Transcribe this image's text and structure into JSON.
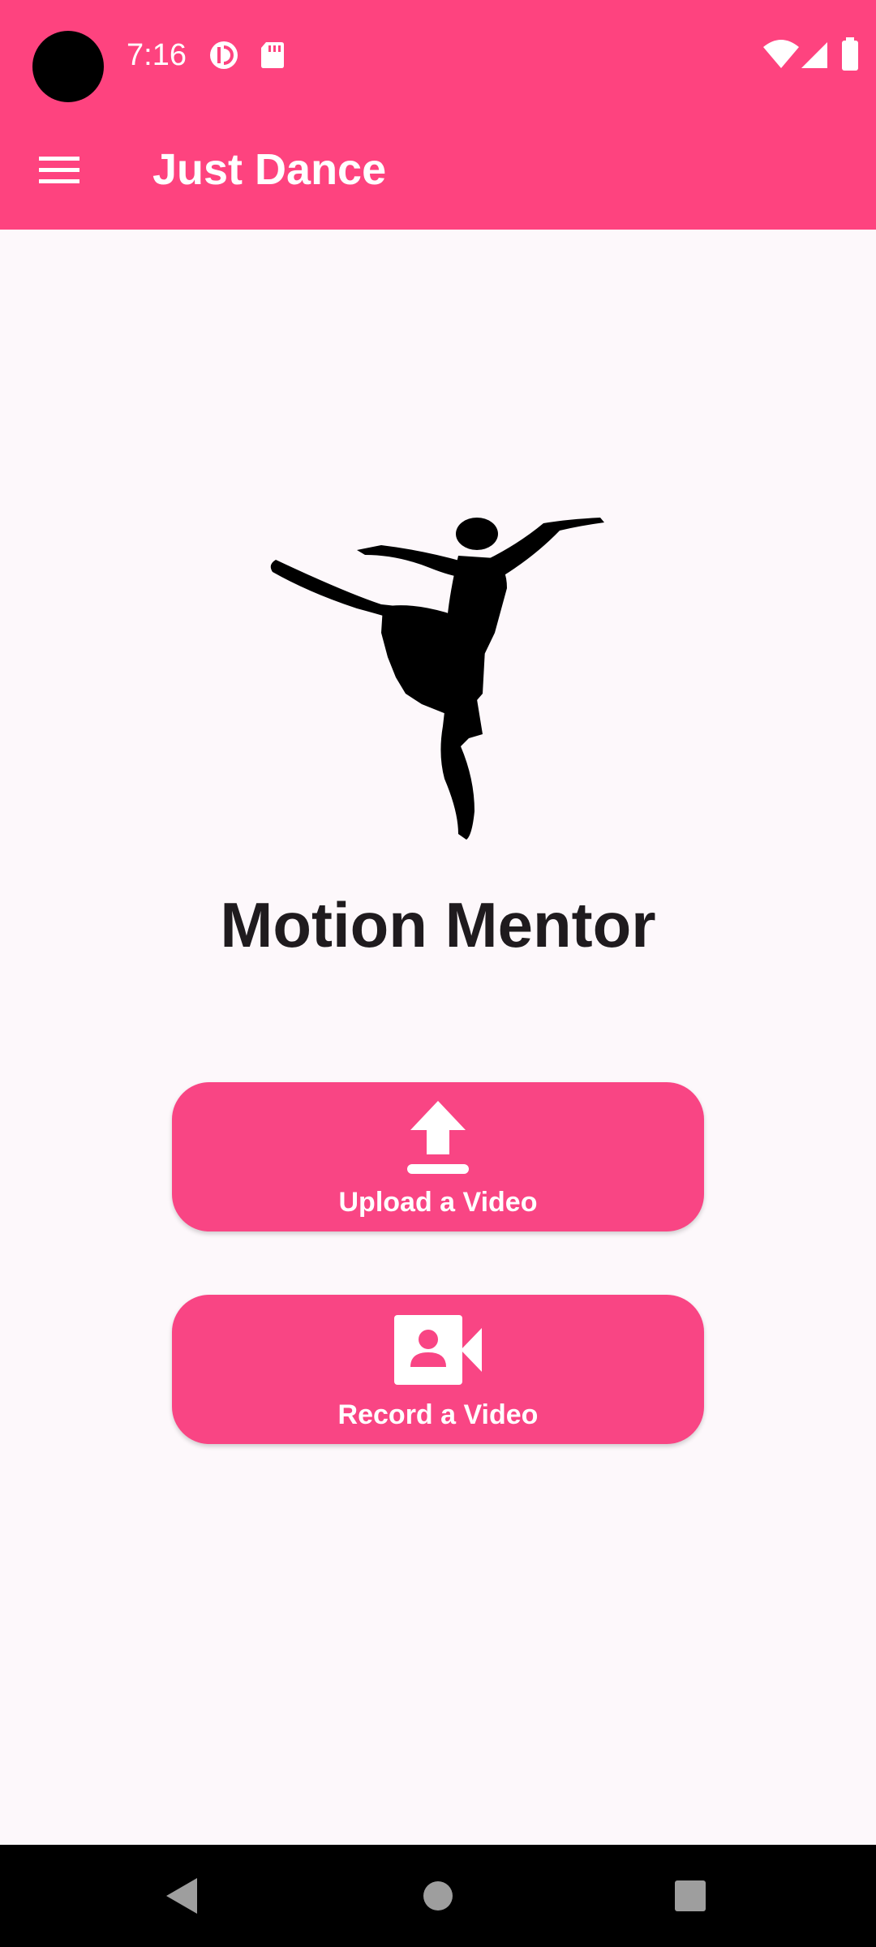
{
  "status_bar": {
    "time": "7:16",
    "icons": [
      "camera-notch-icon",
      "data-saver-icon",
      "sd-card-icon",
      "wifi-icon",
      "cell-signal-icon",
      "battery-icon"
    ]
  },
  "app_bar": {
    "title": "Just Dance",
    "menu_icon": "hamburger-menu-icon"
  },
  "main": {
    "image": "ballerina-silhouette",
    "headline": "Motion Mentor",
    "buttons": [
      {
        "label": "Upload a Video",
        "icon": "upload-icon"
      },
      {
        "label": "Record a Video",
        "icon": "video-camera-icon"
      }
    ]
  },
  "nav_bar": {
    "buttons": [
      "back-icon",
      "home-icon",
      "recents-icon"
    ]
  },
  "colors": {
    "accent": "#fe437f",
    "button": "#f94584",
    "background": "#fdf8fb",
    "text": "#1f1b1e"
  }
}
